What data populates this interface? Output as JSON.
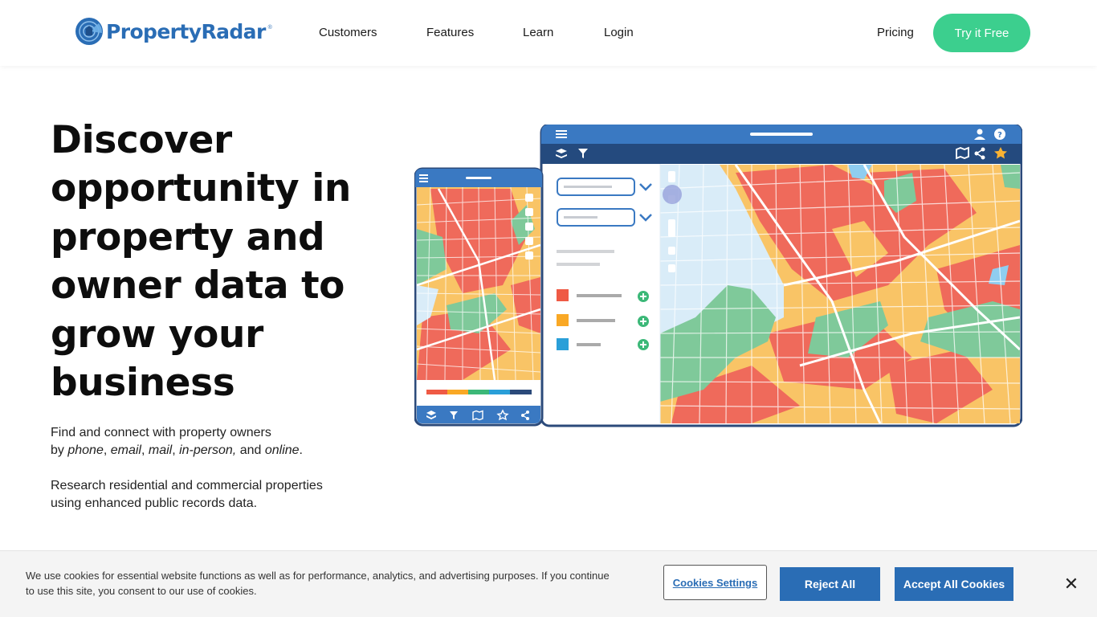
{
  "brand": {
    "name": "PropertyRadar",
    "registered": "®",
    "colors": {
      "primary": "#2a6db5",
      "cta": "#3ccf8e",
      "map_red": "#ef6a5b",
      "map_yellow": "#f9c466",
      "map_green": "#7fc99a",
      "water": "#d9ecf8"
    }
  },
  "nav": {
    "links": [
      "Customers",
      "Features",
      "Learn",
      "Login"
    ],
    "pricing": "Pricing",
    "cta": "Try it Free"
  },
  "hero": {
    "title": "Discover opportunity in property and owner data to grow your business",
    "line1": "Find and connect with property owners",
    "line2_prefix": "by ",
    "channels": [
      "phone",
      "email",
      "mail",
      "in-person,"
    ],
    "and_word": " and ",
    "online": "online",
    "period": ".",
    "research_line1": "Research residential and commercial properties",
    "research_line2": "using enhanced public records data."
  },
  "illustration": {
    "icons": [
      "menu-icon",
      "user-icon",
      "help-icon",
      "layers-icon",
      "filter-icon",
      "map-icon",
      "share-icon",
      "star-icon"
    ],
    "legend_colors": [
      "#ef6a5b",
      "#f9a825",
      "#2a9fd8"
    ]
  },
  "cookie": {
    "text": "We use cookies for essential website functions as well as for performance, analytics, and advertising purposes. If you continue to use this site, you consent to our use of cookies.",
    "settings": "Cookies Settings",
    "reject": "Reject All",
    "accept": "Accept All Cookies",
    "close": "✕"
  }
}
